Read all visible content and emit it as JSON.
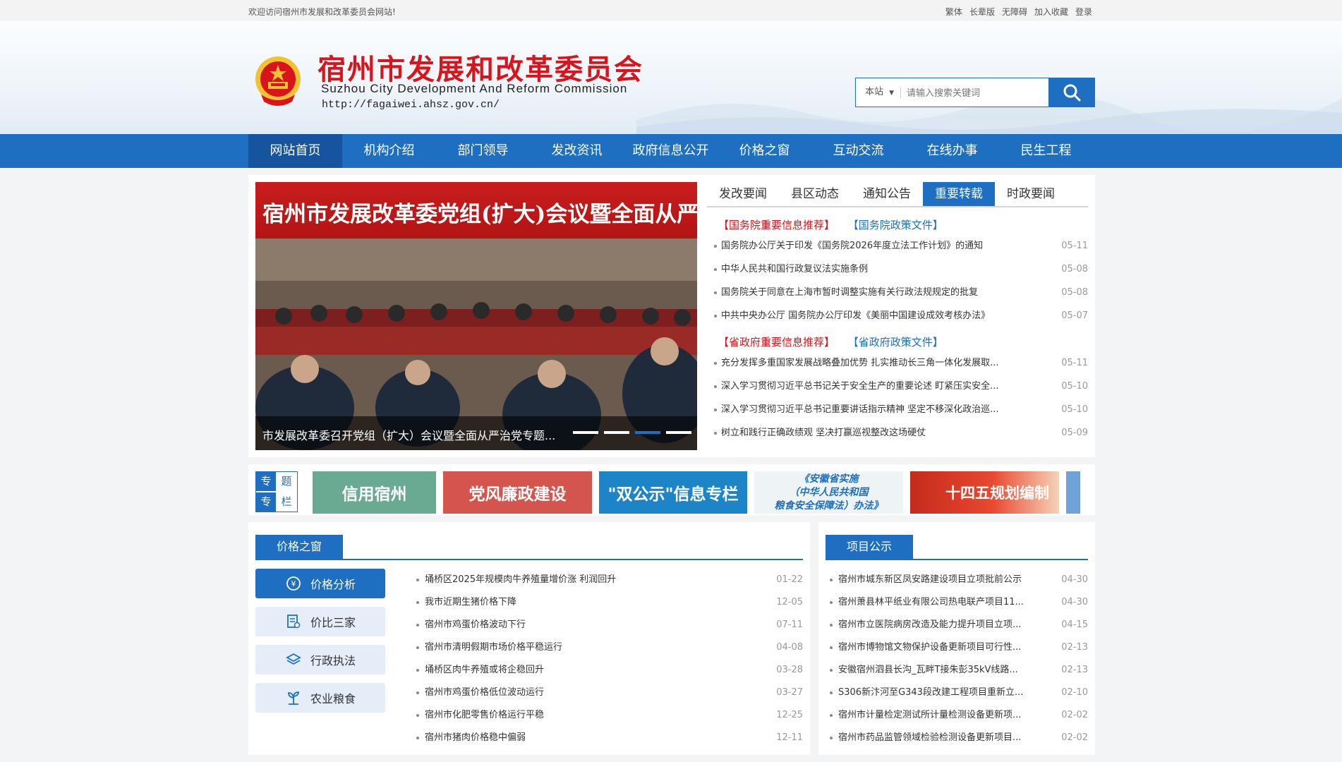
{
  "topbar": {
    "welcome": "欢迎访问宿州市发展和改革委员会网站!",
    "links": [
      "繁体",
      "长辈版",
      "无障碍",
      "加入收藏",
      "登录"
    ]
  },
  "header": {
    "title": "宿州市发展和改革委员会",
    "subtitle_en": "Suzhou City Development And Reform Commission",
    "url": "http://fagaiwei.ahsz.gov.cn/"
  },
  "search": {
    "scope": "本站",
    "placeholder": "请输入搜索关键词"
  },
  "nav": [
    "网站首页",
    "机构介绍",
    "部门领导",
    "发改资讯",
    "政府信息公开",
    "价格之窗",
    "互动交流",
    "在线办事",
    "民生工程"
  ],
  "slider": {
    "banner_text": "宿州市发展改革委党组(扩大)会议暨全面从严治党专题会议",
    "caption": "市发展改革委召开党组（扩大）会议暨全面从严治党专题...",
    "active_dot": 3
  },
  "news": {
    "tabs": [
      "发改要闻",
      "县区动态",
      "通知公告",
      "重要转载",
      "时政要闻"
    ],
    "active_tab": 3,
    "group1": {
      "cat_red": "【国务院重要信息推荐】",
      "cat_blue": "【国务院政策文件】",
      "items": [
        {
          "title": "国务院办公厅关于印发《国务院2026年度立法工作计划》的通知",
          "date": "05-11"
        },
        {
          "title": "中华人民共和国行政复议法实施条例",
          "date": "05-08"
        },
        {
          "title": "国务院关于同意在上海市暂时调整实施有关行政法规规定的批复",
          "date": "05-08"
        },
        {
          "title": "中共中央办公厅 国务院办公厅印发《美丽中国建设成效考核办法》",
          "date": "05-07"
        }
      ]
    },
    "group2": {
      "cat_red": "【省政府重要信息推荐】",
      "cat_blue": "【省政府政策文件】",
      "items": [
        {
          "title": "充分发挥多重国家发展战略叠加优势 扎实推动长三角一体化发展取...",
          "date": "05-11"
        },
        {
          "title": "深入学习贯彻习近平总书记关于安全生产的重要论述 盯紧压实安全...",
          "date": "05-10"
        },
        {
          "title": "深入学习贯彻习近平总书记重要讲话指示精神 坚定不移深化政治巡...",
          "date": "05-10"
        },
        {
          "title": "树立和践行正确政绩观 坚决打赢巡视整改这场硬仗",
          "date": "05-09"
        }
      ]
    }
  },
  "topics": {
    "label": [
      "专",
      "题",
      "专",
      "栏"
    ],
    "banners": [
      "信用宿州",
      "党风廉政建设",
      "\"双公示\"信息专栏",
      "《安徽省实施",
      "（中华人民共和国",
      "粮食安全保障法）办法》",
      "十四五规划编制"
    ]
  },
  "price_window": {
    "title": "价格之窗",
    "side": [
      "价格分析",
      "价比三家",
      "行政执法",
      "农业粮食"
    ],
    "items": [
      {
        "title": "埇桥区2025年规模肉牛养殖量增价涨 利润回升",
        "date": "01-22"
      },
      {
        "title": "我市近期生猪价格下降",
        "date": "12-05"
      },
      {
        "title": "宿州市鸡蛋价格波动下行",
        "date": "07-11"
      },
      {
        "title": "宿州市清明假期市场价格平稳运行",
        "date": "04-08"
      },
      {
        "title": "埇桥区肉牛养殖或将企稳回升",
        "date": "03-28"
      },
      {
        "title": "宿州市鸡蛋价格低位波动运行",
        "date": "03-27"
      },
      {
        "title": "宿州市化肥零售价格运行平稳",
        "date": "12-25"
      },
      {
        "title": "宿州市猪肉价格稳中偏弱",
        "date": "12-11"
      }
    ]
  },
  "projects": {
    "title": "项目公示",
    "items": [
      {
        "title": "宿州市城东新区凤安路建设项目立项批前公示",
        "date": "04-30"
      },
      {
        "title": "宿州萧县林平纸业有限公司热电联产项目11...",
        "date": "04-30"
      },
      {
        "title": "宿州市立医院病房改造及能力提升项目立项...",
        "date": "04-15"
      },
      {
        "title": "宿州市博物馆文物保护设备更新项目可行性...",
        "date": "02-13"
      },
      {
        "title": "安徽宿州泗县长沟_瓦畔T接朱彭35kV线路...",
        "date": "02-13"
      },
      {
        "title": "S306新汴河至G343段改建工程项目重新立...",
        "date": "02-10"
      },
      {
        "title": "宿州市计量检定测试所计量检测设备更新项...",
        "date": "02-02"
      },
      {
        "title": "宿州市药品监管领域检验检测设备更新项目...",
        "date": "02-02"
      }
    ]
  },
  "colors": {
    "brand": "#1e6fc2",
    "title_red": "#d8141c"
  }
}
